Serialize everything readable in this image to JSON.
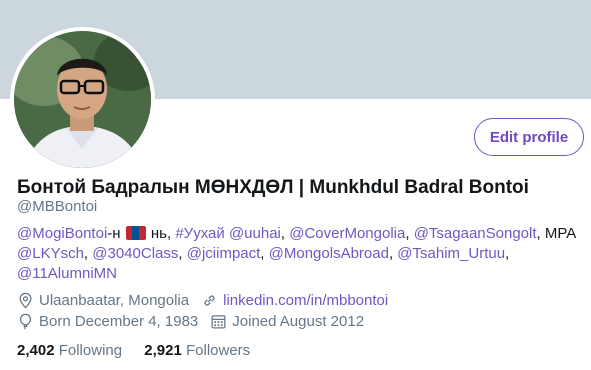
{
  "profile": {
    "name": "Бонтой Бадралын МӨНХДӨЛ | Munkhdul Badral Bontoi",
    "handle": "@MBBontoi",
    "edit_label": "Edit profile",
    "bio": {
      "mention_1": "@MogiBontoi",
      "suffix_1": "-н",
      "flag_icon": "mongolia-flag-icon",
      "text_2": " нь, ",
      "hashtag": "#Уухай",
      "mention_2": "@uuhai",
      "mention_3": "@CoverMongolia",
      "mention_4": "@TsagaanSongolt",
      "text_mpa": "MPA",
      "mention_5": "@LKYsch",
      "mention_6": "@3040Class",
      "mention_7": "@jciimpact",
      "mention_8": "@MongolsAbroad",
      "mention_9": "@Tsahim_Urtuu",
      "mention_10": "@11AlumniMN"
    },
    "location": "Ulaanbaatar, Mongolia",
    "website": "linkedin.com/in/mbbontoi",
    "birthday": "Born December 4, 1983",
    "joined": "Joined August 2012",
    "following_count": "2,402",
    "following_label": "Following",
    "followers_count": "2,921",
    "followers_label": "Followers"
  },
  "colors": {
    "banner": "#ccd6dd",
    "accent": "#7257c2",
    "secondary_text": "#657786"
  },
  "icons": {
    "location": "location-pin-icon",
    "website": "link-icon",
    "birthday": "balloon-icon",
    "joined": "calendar-icon"
  }
}
